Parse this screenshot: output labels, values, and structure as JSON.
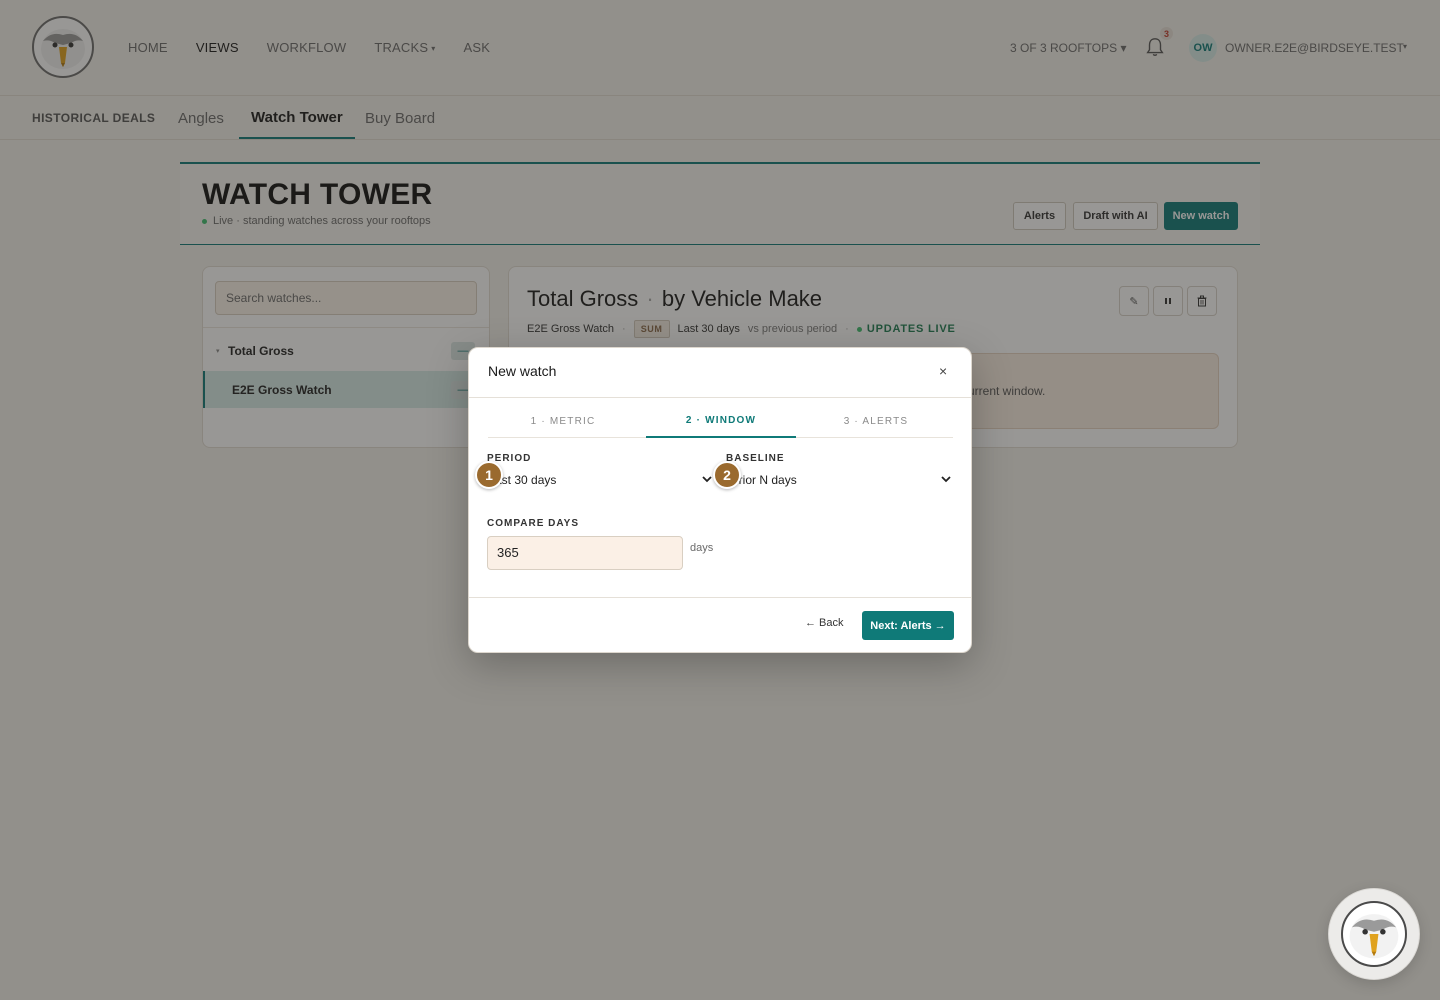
{
  "nav": {
    "links": [
      {
        "label": "HOME",
        "active": false
      },
      {
        "label": "VIEWS",
        "active": true
      },
      {
        "label": "WORKFLOW",
        "active": false
      },
      {
        "label": "TRACKS",
        "active": false
      },
      {
        "label": "ASK",
        "active": false
      }
    ],
    "tracks_caret": "▾",
    "rooftops": "3 OF 3 ROOFTOPS ▾",
    "notification_count": "3",
    "avatar_initials": "OW",
    "user_email": "OWNER.E2E@BIRDSEYE.TEST",
    "user_caret": "▾"
  },
  "subtabs": [
    "HISTORICAL DEALS",
    "Angles",
    "Watch Tower",
    "Buy Board"
  ],
  "header": {
    "title": "WATCH TOWER",
    "subtitle": "Live · standing watches across your rooftops",
    "buttons": {
      "alerts": "Alerts",
      "draft": "Draft with AI",
      "new_watch": "New watch"
    }
  },
  "sidebar": {
    "search_placeholder": "Search watches...",
    "group_caret": "▾",
    "group_label": "Total Gross",
    "group_pill": "—",
    "selected_watch": "E2E Gross Watch",
    "watch_pill": "—"
  },
  "detail": {
    "title_metric": "Total Gross",
    "title_sep": "·",
    "title_dimension": "by Vehicle Make",
    "watch_name": "E2E Gross Watch",
    "sep": "·",
    "agg": "SUM",
    "period": "Last 30 days",
    "baseline": "vs previous period",
    "status": "UPDATES LIVE",
    "info_text": "urrent window.",
    "icon_labels": {
      "edit": "✎",
      "pause": "⏸",
      "delete": "🗑"
    }
  },
  "modal": {
    "title": "New watch",
    "close": "×",
    "steps": [
      "1 · METRIC",
      "2 · WINDOW",
      "3 · ALERTS"
    ],
    "period_label": "PERIOD",
    "period_value": "ast 30 days",
    "baseline_label": "BASELINE",
    "baseline_value": " prior N days",
    "compare_label": "COMPARE DAYS",
    "compare_value": "365",
    "compare_unit": "days",
    "back": "← Back",
    "next": "Next: Alerts →"
  },
  "markers": [
    "1",
    "2"
  ],
  "colors": {
    "accent": "#0f7a78",
    "marker": "#9a6a2e",
    "live": "#3fbf6f"
  }
}
